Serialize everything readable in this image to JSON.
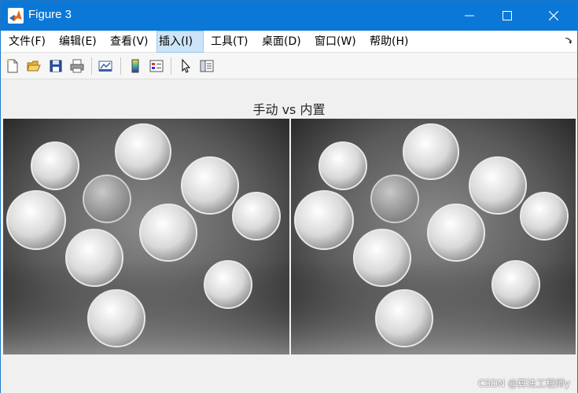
{
  "window": {
    "title": "Figure 3",
    "icon": "matlab-logo-icon",
    "controls": [
      "minimize-icon",
      "maximize-icon",
      "close-icon"
    ]
  },
  "menu": {
    "items": [
      {
        "label": "文件(F)"
      },
      {
        "label": "编辑(E)"
      },
      {
        "label": "查看(V)"
      },
      {
        "label": "插入(I)"
      },
      {
        "label": "工具(T)"
      },
      {
        "label": "桌面(D)"
      },
      {
        "label": "窗口(W)"
      },
      {
        "label": "帮助(H)"
      }
    ],
    "active": "插入(I)"
  },
  "toolbar": {
    "buttons": [
      "new-figure-icon",
      "open-file-icon",
      "save-icon",
      "print-icon",
      "link-plot-icon",
      "insert-colorbar-icon",
      "insert-legend-icon",
      "edit-plot-arrow-icon",
      "property-inspector-icon"
    ]
  },
  "figure": {
    "title": "手动 vs 内置",
    "panels": [
      "manual-result-image",
      "builtin-result-image"
    ]
  },
  "watermark": "CSDN @算法工程师y",
  "colors": {
    "titlebar": "#0b78d7",
    "menu_active": "#cce4f7"
  }
}
